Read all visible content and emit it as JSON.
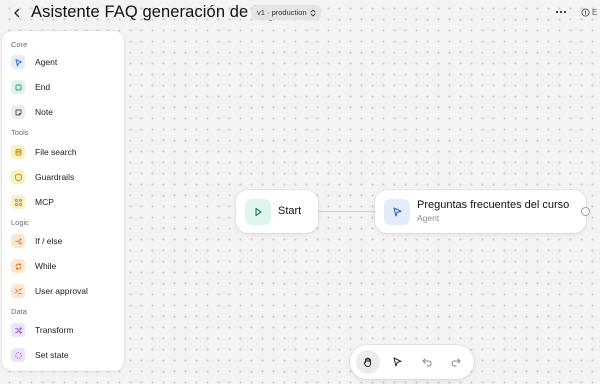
{
  "header": {
    "title": "Asistente FAQ generación de ingresos",
    "version_label": "v1 · production",
    "right_label": "E"
  },
  "sidebar": {
    "sections": [
      {
        "label": "Core",
        "items": [
          {
            "label": "Agent",
            "icon": "agent-icon",
            "color": "#e3ecfb"
          },
          {
            "label": "End",
            "icon": "end-icon",
            "color": "#dff3e8"
          },
          {
            "label": "Note",
            "icon": "note-icon",
            "color": "#ececec"
          }
        ]
      },
      {
        "label": "Tools",
        "items": [
          {
            "label": "File search",
            "icon": "database-icon",
            "color": "#fbf0c2"
          },
          {
            "label": "Guardrails",
            "icon": "shield-icon",
            "color": "#fbf0c2"
          },
          {
            "label": "MCP",
            "icon": "mcp-icon",
            "color": "#fbf0c2"
          }
        ]
      },
      {
        "label": "Logic",
        "items": [
          {
            "label": "If / else",
            "icon": "branch-icon",
            "color": "#fde6cf"
          },
          {
            "label": "While",
            "icon": "loop-icon",
            "color": "#fde6cf"
          },
          {
            "label": "User approval",
            "icon": "approval-icon",
            "color": "#fde6cf"
          }
        ]
      },
      {
        "label": "Data",
        "items": [
          {
            "label": "Transform",
            "icon": "transform-icon",
            "color": "#ece3fa"
          },
          {
            "label": "Set state",
            "icon": "set-state-icon",
            "color": "#ece3fa"
          }
        ]
      }
    ]
  },
  "canvas": {
    "start_node": {
      "title": "Start"
    },
    "agent_node": {
      "title": "Preguntas frecuentes del curso",
      "subtitle": "Agent"
    }
  },
  "toolbar": {
    "buttons": [
      {
        "name": "hand-tool",
        "active": true
      },
      {
        "name": "select-tool",
        "active": false
      },
      {
        "name": "undo",
        "active": false
      },
      {
        "name": "redo",
        "active": false
      }
    ]
  }
}
